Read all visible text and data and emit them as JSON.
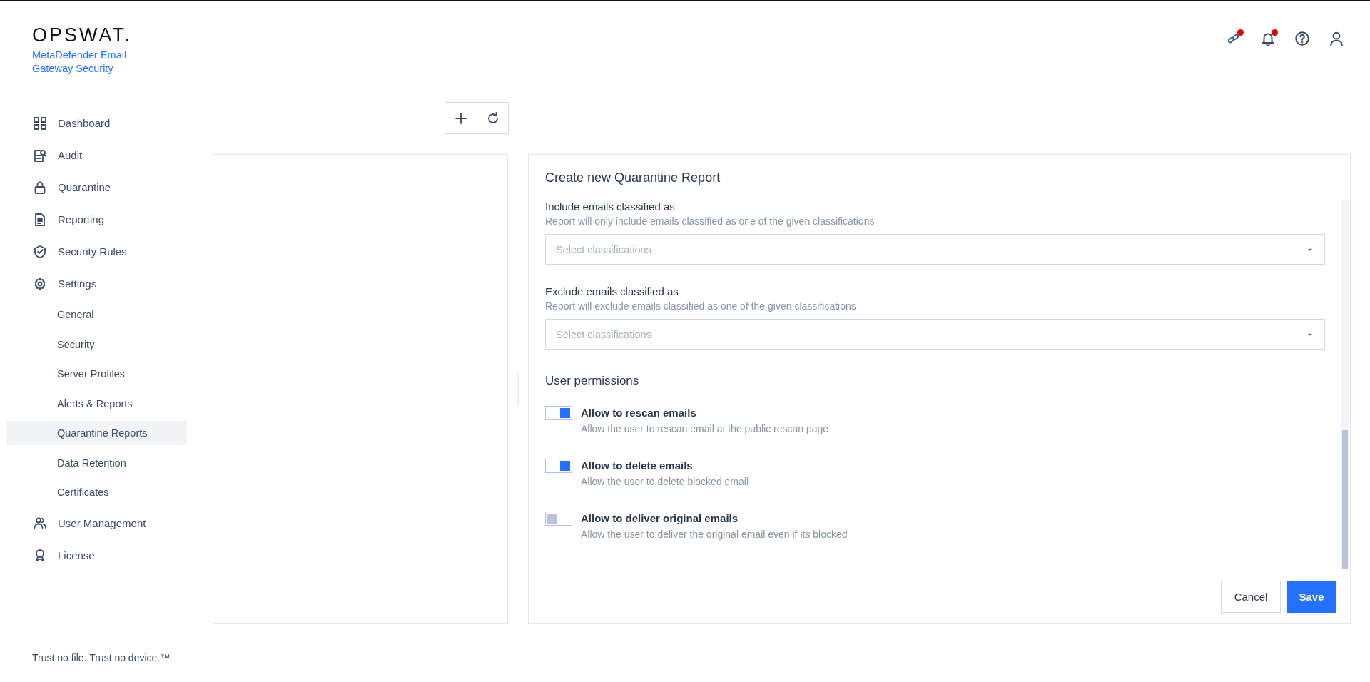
{
  "brand": {
    "logo": "OPSWAT.",
    "product": "MetaDefender Email Gateway Security"
  },
  "header": {
    "icons": [
      {
        "kind": "link",
        "badge": true
      },
      {
        "kind": "bell",
        "badge": true
      },
      {
        "kind": "help",
        "badge": false
      },
      {
        "kind": "user",
        "badge": false
      }
    ]
  },
  "sidebar": {
    "items": [
      {
        "label": "Dashboard",
        "selected": false
      },
      {
        "label": "Audit",
        "selected": false
      },
      {
        "label": "Quarantine",
        "selected": false
      },
      {
        "label": "Reporting",
        "selected": false
      },
      {
        "label": "Security Rules",
        "selected": false
      },
      {
        "label": "Settings",
        "selected": false,
        "children": [
          {
            "label": "General",
            "selected": false
          },
          {
            "label": "Security",
            "selected": false
          },
          {
            "label": "Server Profiles",
            "selected": false
          },
          {
            "label": "Alerts & Reports",
            "selected": false
          },
          {
            "label": "Quarantine Reports",
            "selected": true
          },
          {
            "label": "Data Retention",
            "selected": false
          },
          {
            "label": "Certificates",
            "selected": false
          }
        ]
      },
      {
        "label": "User Management",
        "selected": false
      },
      {
        "label": "License",
        "selected": false
      }
    ],
    "footer": "Trust no file. Trust no device.™"
  },
  "toolbar": {
    "buttons": [
      {
        "kind": "add"
      },
      {
        "kind": "refresh"
      }
    ]
  },
  "form": {
    "title": "Create new Quarantine Report",
    "selects": [
      {
        "label": "Include emails classified as",
        "hint": "Report will only include emails classified as one of the given classifications",
        "placeholder": "Select classifications"
      },
      {
        "label": "Exclude emails classified as",
        "hint": "Report will exclude emails classified as one of the given classifications",
        "placeholder": "Select classifications"
      }
    ],
    "section": "User permissions",
    "toggles": [
      {
        "label": "Allow to rescan emails",
        "description": "Allow the user to rescan email at the public rescan page",
        "on": true
      },
      {
        "label": "Allow to delete emails",
        "description": "Allow the user to delete blocked email",
        "on": true
      },
      {
        "label": "Allow to deliver original emails",
        "description": "Allow the user to deliver the original email even if its blocked",
        "on": false
      }
    ],
    "buttons": [
      {
        "label": "Cancel",
        "kind": "secondary"
      },
      {
        "label": "Save",
        "kind": "primary"
      }
    ]
  }
}
